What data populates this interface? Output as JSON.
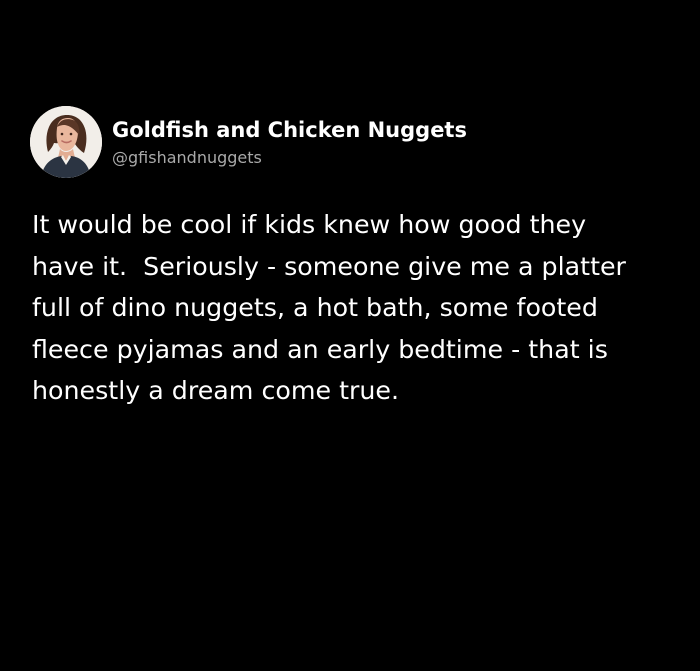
{
  "author": {
    "display_name": "Goldfish and Chicken Nuggets",
    "handle": "@gfishandnuggets",
    "avatar_icon": "profile-photo-avatar"
  },
  "tweet": {
    "lines": [
      "It would be cool if kids knew how good they",
      "have it.  Seriously - someone give me a platter",
      "full of dino nuggets, a hot bath, some footed",
      "fleece pyjamas and an early bedtime - that is",
      "honestly a dream come true."
    ]
  },
  "colors": {
    "background": "#000000",
    "text": "#ffffff",
    "handle": "#a9a9a9"
  }
}
